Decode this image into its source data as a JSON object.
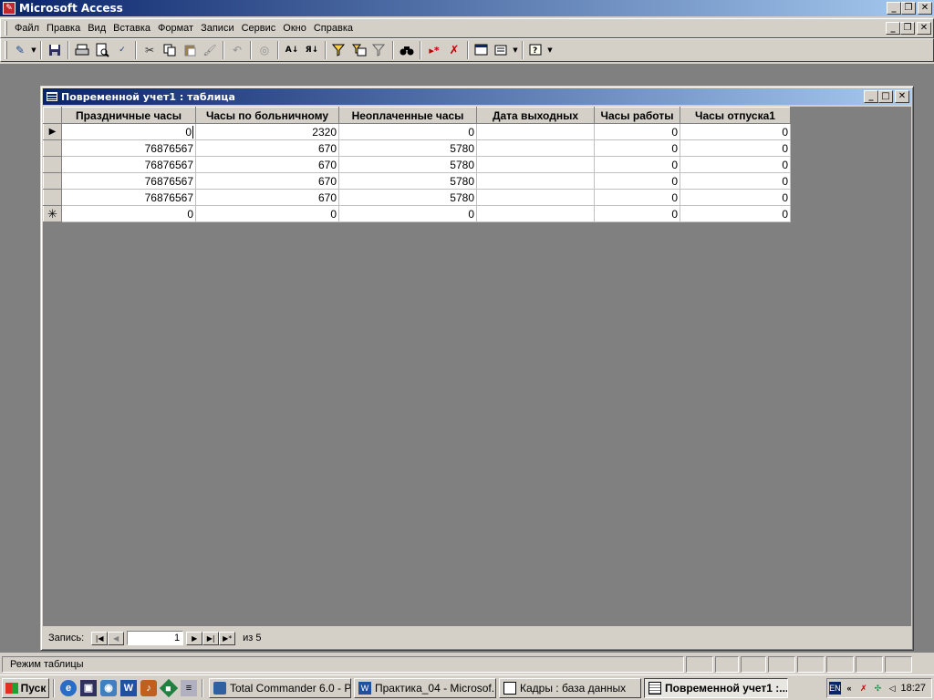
{
  "app": {
    "title": "Microsoft Access"
  },
  "menu": [
    "Файл",
    "Правка",
    "Вид",
    "Вставка",
    "Формат",
    "Записи",
    "Сервис",
    "Окно",
    "Справка"
  ],
  "document": {
    "title": "Повременной учет1 : таблица",
    "columns": [
      "Праздничные часы",
      "Часы по больничному",
      "Неоплаченные  часы",
      "Дата выходных",
      "Часы работы",
      "Часы  отпуска1"
    ],
    "rows": [
      [
        "0",
        "2320",
        "0",
        "",
        "0",
        "0"
      ],
      [
        "76876567",
        "670",
        "5780",
        "",
        "0",
        "0"
      ],
      [
        "76876567",
        "670",
        "5780",
        "",
        "0",
        "0"
      ],
      [
        "76876567",
        "670",
        "5780",
        "",
        "0",
        "0"
      ],
      [
        "76876567",
        "670",
        "5780",
        "",
        "0",
        "0"
      ]
    ],
    "new_row": [
      "0",
      "0",
      "0",
      "",
      "0",
      "0"
    ],
    "nav": {
      "label": "Запись:",
      "current": "1",
      "total_label": "из 5"
    }
  },
  "status": {
    "text": "Режим таблицы"
  },
  "taskbar": {
    "start": "Пуск",
    "tasks": [
      "Total Commander 6.0 - P...",
      "Практика_04 - Microsof...",
      "Кадры : база данных",
      "Повременной учет1 :..."
    ],
    "language": "EN",
    "clock": "18:27"
  }
}
